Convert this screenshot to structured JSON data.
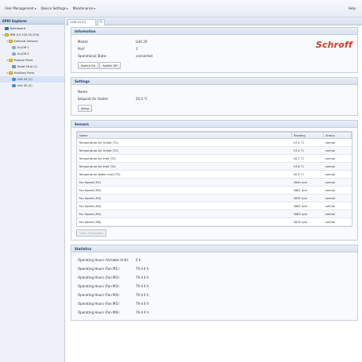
{
  "menubar": {
    "items": [
      {
        "label": "User Management"
      },
      {
        "label": "Device Settings"
      },
      {
        "label": "Maintenance"
      }
    ],
    "help": "Help"
  },
  "explorer": {
    "title": "EPIO Explorer",
    "nodes": [
      {
        "label": "Dashboard",
        "icon": "dashboard-icon",
        "depth": 0,
        "expander": ""
      },
      {
        "label": "BMI (10.103.35.204)",
        "icon": "folder-icon",
        "depth": 0,
        "expander": "minus"
      },
      {
        "label": "External Sensors",
        "icon": "folder-icon",
        "depth": 1,
        "expander": "minus"
      },
      {
        "label": "On/Off 1",
        "icon": "sensor-icon",
        "depth": 2,
        "expander": ""
      },
      {
        "label": "On/Off 2",
        "icon": "sensor-icon",
        "depth": 2,
        "expander": ""
      },
      {
        "label": "Feature Ports",
        "icon": "folder-icon",
        "depth": 1,
        "expander": "minus"
      },
      {
        "label": "Asset Strip (1)",
        "icon": "port-icon",
        "depth": 2,
        "expander": ""
      },
      {
        "label": "Auxiliary Ports",
        "icon": "folder-icon",
        "depth": 1,
        "expander": "minus"
      },
      {
        "label": "LHX 20 (1)",
        "icon": "unit-icon",
        "depth": 2,
        "expander": ""
      },
      {
        "label": "LHX 40 (2)",
        "icon": "unit-icon",
        "depth": 2,
        "expander": ""
      }
    ]
  },
  "tab": {
    "label": "LHX 20 (1)"
  },
  "information": {
    "title": "Information",
    "rows": [
      {
        "label": "Model:",
        "value": "LHX 20"
      },
      {
        "label": "Port:",
        "value": "1"
      },
      {
        "label": "Operational State:",
        "value": "connected"
      }
    ],
    "switch_on": "Switch On",
    "switch_off": "Switch Off",
    "logo": "Schroff"
  },
  "settings": {
    "title": "Settings",
    "rows": [
      {
        "label": "Name:",
        "value": ""
      },
      {
        "label": "Setpoint Air Outlet:",
        "value": "20.0 °C"
      }
    ],
    "setup": "Setup"
  },
  "sensors": {
    "title": "Sensors",
    "columns": [
      "Name",
      "Reading",
      "Status"
    ],
    "rows": [
      {
        "name": "Temperature Air Outlet (T1)",
        "reading": "19.5 °C",
        "status": "normal"
      },
      {
        "name": "Temperature Air Outlet (T2)",
        "reading": "19.5 °C",
        "status": "normal"
      },
      {
        "name": "Temperature Air Inlet (T3)",
        "reading": "18.7 °C",
        "status": "normal"
      },
      {
        "name": "Temperature Air Inlet (T4)",
        "reading": "19.6 °C",
        "status": "normal"
      },
      {
        "name": "Temperature Water Inlet (T5)",
        "reading": "20.9 °C",
        "status": "normal"
      },
      {
        "name": "Fan Speed (M1)",
        "reading": "2840 rpm",
        "status": "normal"
      },
      {
        "name": "Fan Speed (M2)",
        "reading": "2881 rpm",
        "status": "normal"
      },
      {
        "name": "Fan Speed (M3)",
        "reading": "2839 rpm",
        "status": "normal"
      },
      {
        "name": "Fan Speed (M4)",
        "reading": "2882 rpm",
        "status": "normal"
      },
      {
        "name": "Fan Speed (M5)",
        "reading": "2883 rpm",
        "status": "normal"
      },
      {
        "name": "Fan Speed (M6)",
        "reading": "2876 rpm",
        "status": "normal"
      }
    ],
    "clear_button": "Clear Thresholds"
  },
  "statistics": {
    "title": "Statistics",
    "rows": [
      {
        "label": "Operating Hours (Variable Unit):",
        "value": "0 h"
      },
      {
        "label": "Operating Hours (Fan M1):",
        "value": "79 d 4 h"
      },
      {
        "label": "Operating Hours (Fan M2):",
        "value": "79 d 4 h"
      },
      {
        "label": "Operating Hours (Fan M3):",
        "value": "79 d 4 h"
      },
      {
        "label": "Operating Hours (Fan M4):",
        "value": "79 d 4 h"
      },
      {
        "label": "Operating Hours (Fan M5):",
        "value": "79 d 4 h"
      },
      {
        "label": "Operating Hours (Fan M6):",
        "value": "79 d 4 h"
      }
    ]
  },
  "colors": {
    "accent": "#203a60",
    "logo": "#d13a24",
    "refresh": "#2f9a2f"
  }
}
